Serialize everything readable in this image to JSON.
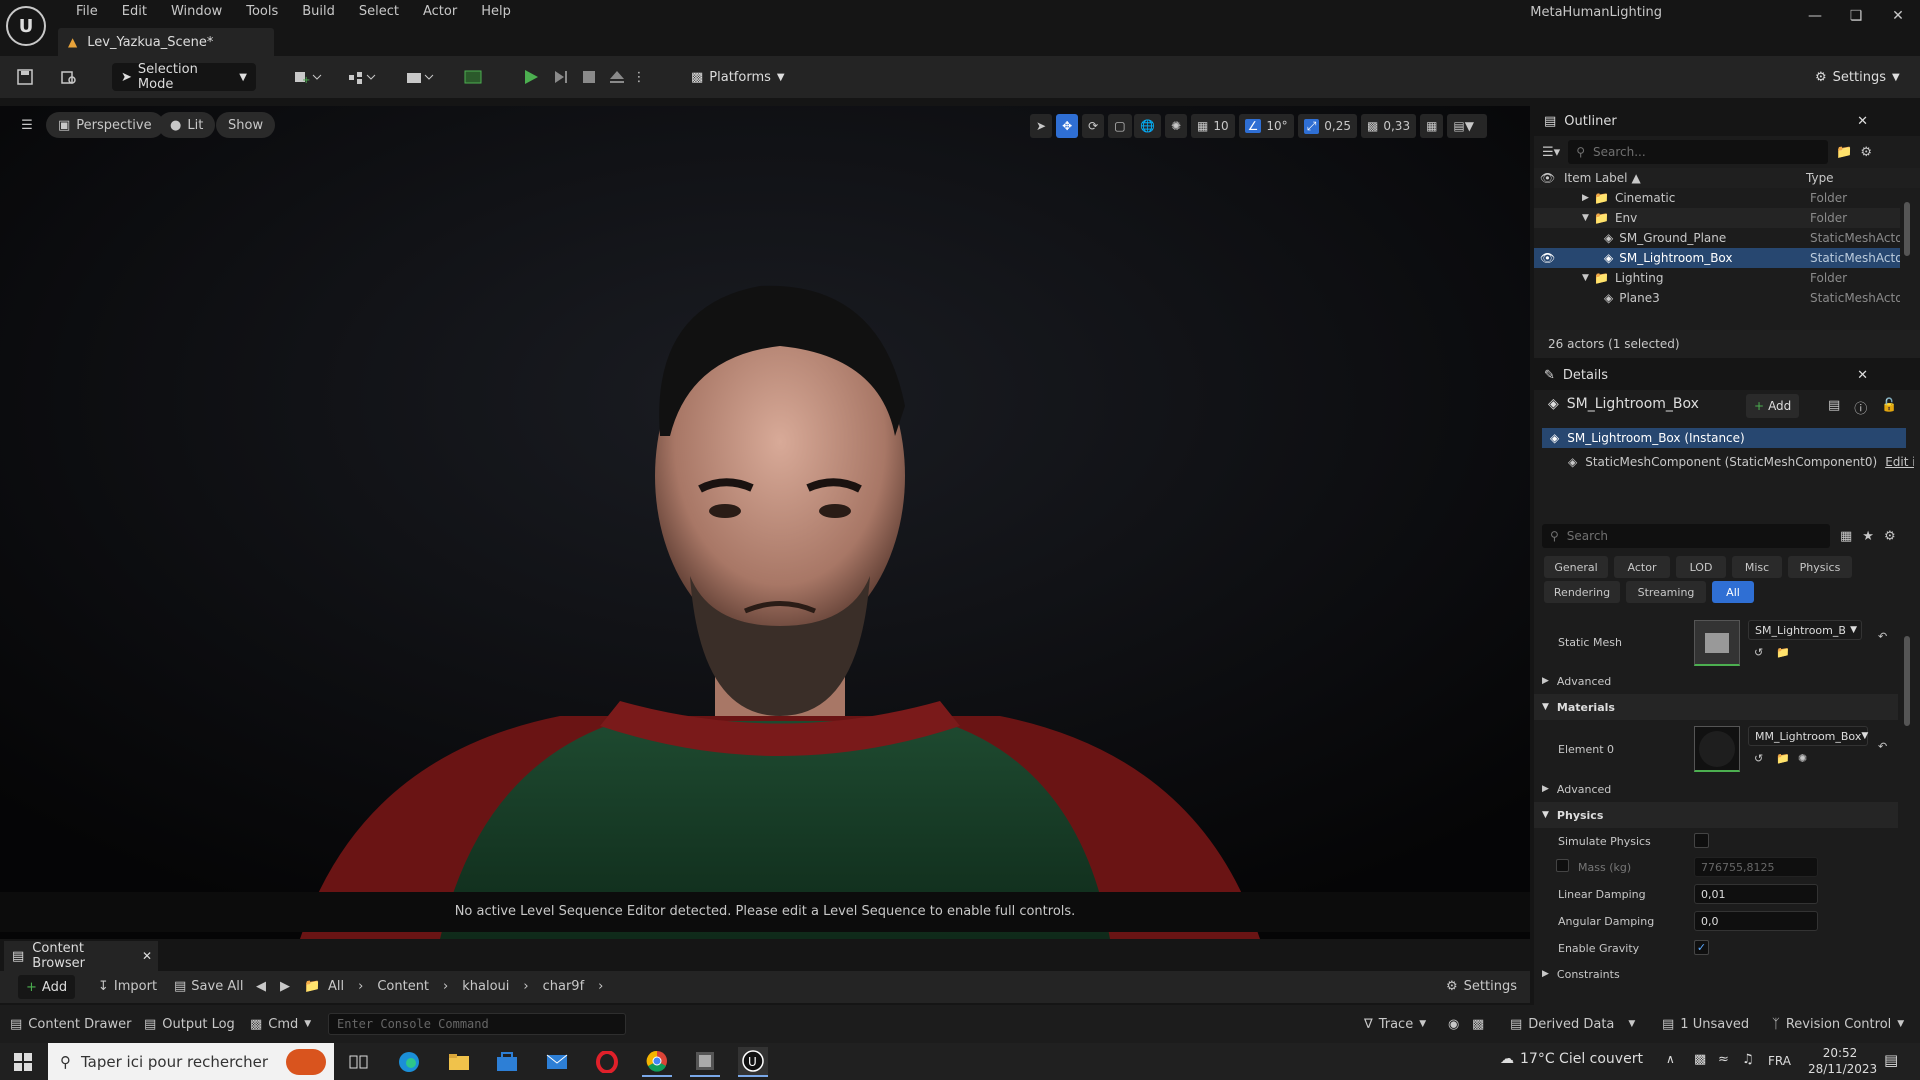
{
  "titlebar": {
    "menu": [
      "File",
      "Edit",
      "Window",
      "Tools",
      "Build",
      "Select",
      "Actor",
      "Help"
    ],
    "document_tab": "Lev_Yazkua_Scene*",
    "app_title": "MetaHumanLighting",
    "logo_text": "U"
  },
  "toolbar": {
    "selection_mode": "Selection Mode",
    "platforms": "Platforms",
    "settings": "Settings"
  },
  "viewport": {
    "perspective": "Perspective",
    "lit": "Lit",
    "show": "Show",
    "grid_snap": "10",
    "rotation_snap": "10°",
    "scale_snap": "0,25",
    "camera_speed": "0,33",
    "message": "No active Level Sequence Editor detected. Please edit a Level Sequence to enable full controls."
  },
  "outliner": {
    "tab": "Outliner",
    "search_placeholder": "Search...",
    "col_label": "Item Label",
    "col_type": "Type",
    "rows": [
      {
        "label": "Cinematic",
        "type": "Folder"
      },
      {
        "label": "Env",
        "type": "Folder"
      },
      {
        "label": "SM_Ground_Plane",
        "type": "StaticMeshActo"
      },
      {
        "label": "SM_Lightroom_Box",
        "type": "StaticMeshActo"
      },
      {
        "label": "Lighting",
        "type": "Folder"
      },
      {
        "label": "Plane3",
        "type": "StaticMeshActo"
      }
    ],
    "footer": "26 actors (1 selected)"
  },
  "details": {
    "tab": "Details",
    "actor_name": "SM_Lightroom_Box",
    "add_label": "Add",
    "instance": "SM_Lightroom_Box (Instance)",
    "component": "StaticMeshComponent (StaticMeshComponent0)",
    "edit_link": "Edit i",
    "search_placeholder": "Search",
    "categories_row1": [
      "General",
      "Actor",
      "LOD",
      "Misc",
      "Physics"
    ],
    "categories_row2": [
      "Rendering",
      "Streaming",
      "All"
    ],
    "static_mesh_label": "Static Mesh",
    "static_mesh_value": "SM_Lightroom_B",
    "advanced1": "Advanced",
    "materials": "Materials",
    "element0_label": "Element 0",
    "element0_value": "MM_Lightroom_Box",
    "advanced2": "Advanced",
    "physics": "Physics",
    "simulate_physics": "Simulate Physics",
    "mass_label": "Mass (kg)",
    "mass_value": "776755,8125",
    "linear_damping_label": "Linear Damping",
    "linear_damping_value": "0,01",
    "angular_damping_label": "Angular Damping",
    "angular_damping_value": "0,0",
    "enable_gravity": "Enable Gravity",
    "constraints": "Constraints"
  },
  "content_browser": {
    "tab": "Content Browser",
    "add": "Add",
    "import": "Import",
    "save_all": "Save All",
    "path": [
      "All",
      "Content",
      "khaloui",
      "char9f"
    ],
    "settings": "Settings"
  },
  "statusbar": {
    "content_drawer": "Content Drawer",
    "output_log": "Output Log",
    "cmd": "Cmd",
    "console_placeholder": "Enter Console Command",
    "trace": "Trace",
    "derived_data": "Derived Data",
    "unsaved": "1 Unsaved",
    "revision_control": "Revision Control"
  },
  "taskbar": {
    "search_placeholder": "Taper ici pour rechercher",
    "weather": "17°C  Ciel couvert",
    "lang": "FRA",
    "time": "20:52",
    "date": "28/11/2023"
  },
  "colors": {
    "accent": "#2f6fd4",
    "selection": "#274770",
    "play_green": "#4caf50"
  }
}
